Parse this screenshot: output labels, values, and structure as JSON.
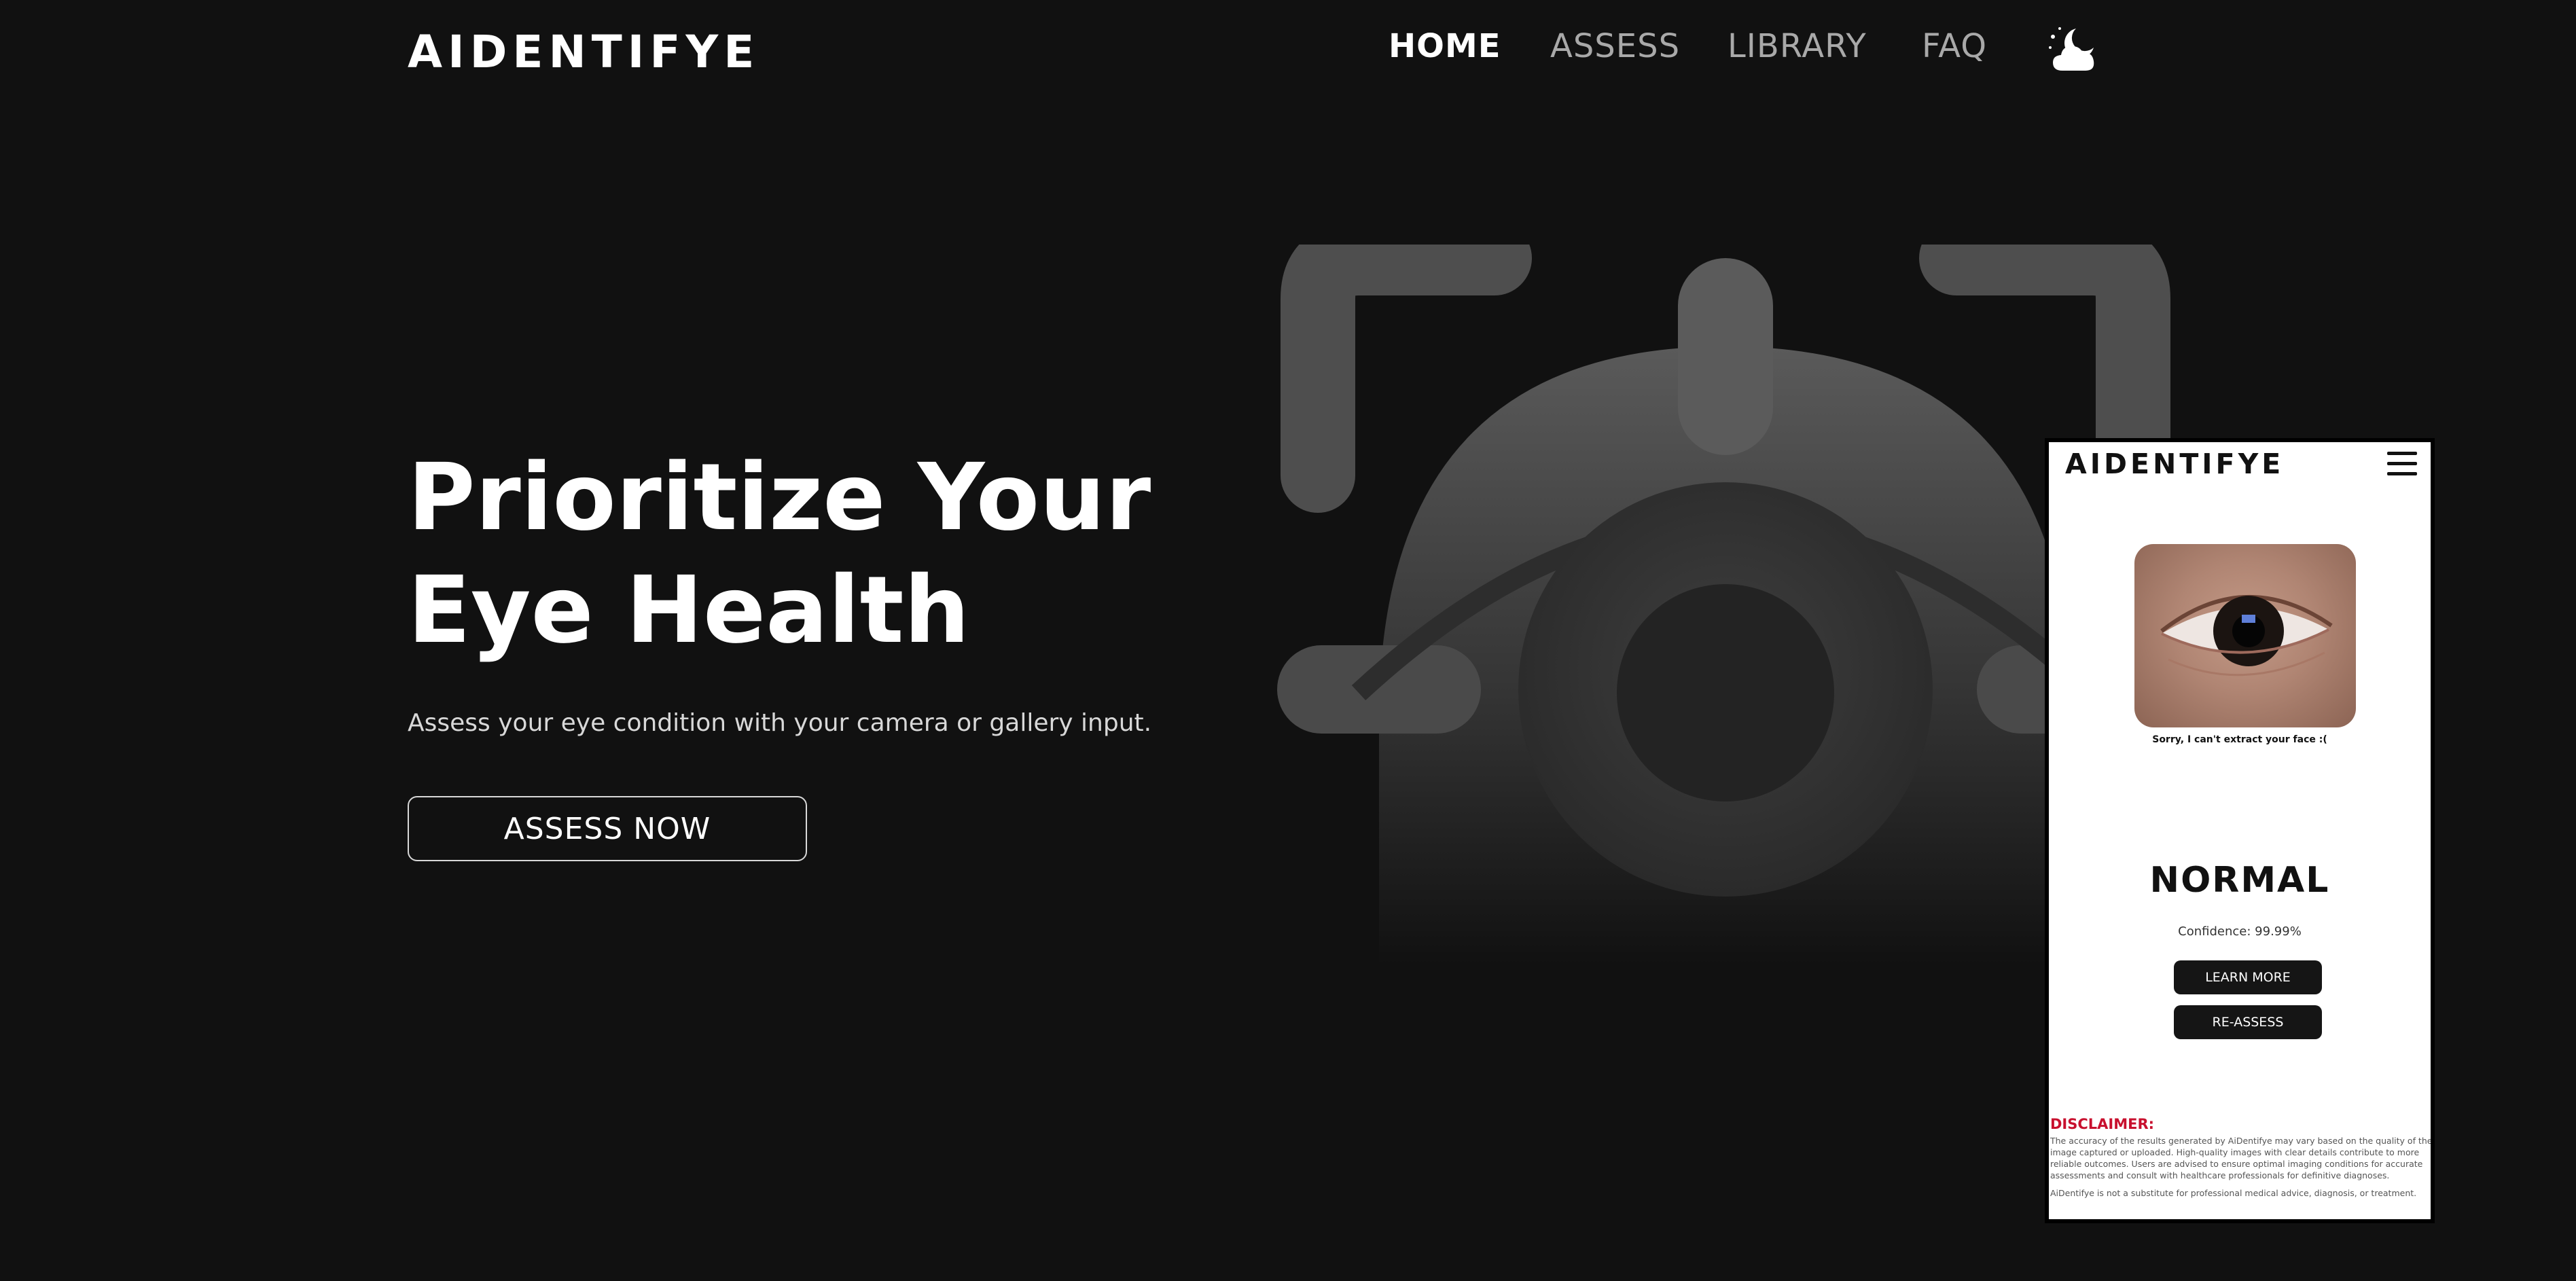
{
  "brand": "AIDENTIFYE",
  "nav": {
    "items": [
      {
        "label": "HOME",
        "active": true
      },
      {
        "label": "ASSESS",
        "active": false
      },
      {
        "label": "LIBRARY",
        "active": false
      },
      {
        "label": "FAQ",
        "active": false
      }
    ],
    "theme_icon": "cloud-moon-icon"
  },
  "hero": {
    "title_line1": "Prioritize Your",
    "title_line2": "Eye Health",
    "subtitle": "Assess your eye condition with your camera or gallery input.",
    "cta_label": "ASSESS NOW",
    "illustration_icon": "eye-scan-icon"
  },
  "mobile": {
    "brand": "AIDENTIFYE",
    "menu_icon": "hamburger-menu-icon",
    "photo_icon": "eye-photo",
    "message": "Sorry, I can't extract your face :(",
    "result": "NORMAL",
    "confidence": "Confidence: 99.99%",
    "learn_more_label": "LEARN MORE",
    "reassess_label": "RE-ASSESS",
    "disclaimer_title": "DISCLAIMER:",
    "disclaimer_body": "The accuracy of the results generated by AiDentifye may vary based on the quality of the image captured or uploaded. High-quality images with clear details contribute to more reliable outcomes. Users are advised to ensure optimal imaging conditions for accurate assessments and consult with healthcare professionals for definitive diagnoses.",
    "disclaimer_foot": "AiDentifye is not a substitute for professional medical advice, diagnosis, or treatment."
  },
  "colors": {
    "background": "#111111",
    "text": "#ffffff",
    "nav_inactive": "#a9a9a9",
    "disclaimer": "#c8102e"
  }
}
